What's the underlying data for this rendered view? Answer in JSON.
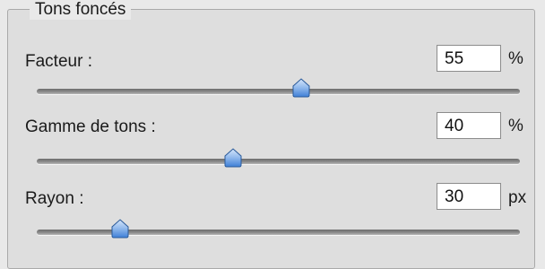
{
  "group": {
    "title": "Tons foncés"
  },
  "controls": [
    {
      "label": "Facteur :",
      "value": "55",
      "unit": "%",
      "slider_fraction": 0.55
    },
    {
      "label": "Gamme de tons :",
      "value": "40",
      "unit": "%",
      "slider_fraction": 0.4
    },
    {
      "label": "Rayon :",
      "value": "30",
      "unit": "px",
      "slider_fraction": 0.15
    }
  ],
  "colors": {
    "thumb_top": "#c9dcf6",
    "thumb_bottom": "#3f7fd6",
    "thumb_outline": "#2a5a9a"
  }
}
